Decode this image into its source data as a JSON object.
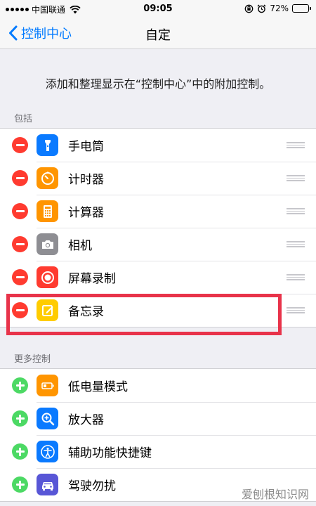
{
  "status_bar": {
    "carrier": "中国联通",
    "time": "09:05",
    "battery": "72%",
    "battery_level": 0.72
  },
  "nav": {
    "back_label": "控制中心",
    "title": "自定"
  },
  "description": "添加和整理显示在“控制中心”中的附加控制。",
  "sections": {
    "included": {
      "header": "包括",
      "items": [
        {
          "label": "手电筒",
          "icon": "flashlight-icon",
          "color": "#0a7aff"
        },
        {
          "label": "计时器",
          "icon": "timer-icon",
          "color": "#ff9500"
        },
        {
          "label": "计算器",
          "icon": "calculator-icon",
          "color": "#ff9500"
        },
        {
          "label": "相机",
          "icon": "camera-icon",
          "color": "#8e8e93"
        },
        {
          "label": "屏幕录制",
          "icon": "screen-record-icon",
          "color": "#ff3b30"
        },
        {
          "label": "备忘录",
          "icon": "notes-icon",
          "color": "#ffcc00"
        }
      ]
    },
    "more": {
      "header": "更多控制",
      "items": [
        {
          "label": "低电量模式",
          "icon": "low-power-icon",
          "color": "#ff9500"
        },
        {
          "label": "放大器",
          "icon": "magnifier-icon",
          "color": "#0a7aff"
        },
        {
          "label": "辅助功能快捷键",
          "icon": "accessibility-icon",
          "color": "#0a7aff"
        },
        {
          "label": "驾驶勿扰",
          "icon": "car-icon",
          "color": "#5856d6"
        }
      ]
    }
  },
  "watermark": "爱刨根知识网"
}
